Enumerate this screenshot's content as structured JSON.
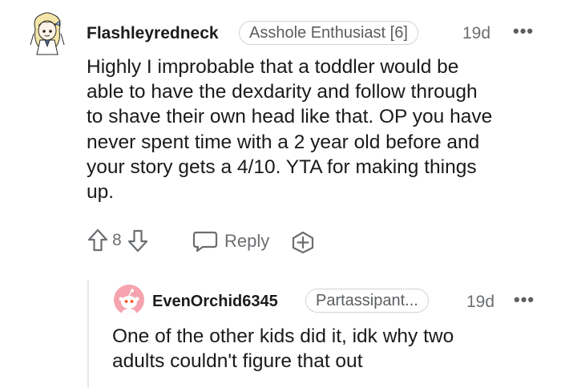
{
  "comment": {
    "username": "Flashleyredneck",
    "flair": "Asshole Enthusiast [6]",
    "time": "19d",
    "more": "•••",
    "body_lines": [
      "Highly I improbable that a toddler would be",
      "able to have the dexdarity and follow through",
      "to shave their own head like that. OP you have",
      "never spent time with a 2 year old before and",
      "your story gets a 4/10. YTA for making things",
      "up."
    ],
    "votes": "8",
    "reply_label": "Reply"
  },
  "reply": {
    "username": "EvenOrchid6345",
    "flair": "Partassipant...",
    "time": "19d",
    "more": "•••",
    "body_lines": [
      "One of the other kids did it, idk why two",
      "adults couldn't figure that out"
    ]
  },
  "colors": {
    "avatar_reply_bg": "#f5a3ae",
    "text": "#1a1a1b",
    "meta": "#6b6e71"
  },
  "icons": {
    "upvote": "arrow-up-outline-icon",
    "downvote": "arrow-down-outline-icon",
    "reply": "speech-bubble-icon",
    "award": "plus-circle-icon"
  }
}
